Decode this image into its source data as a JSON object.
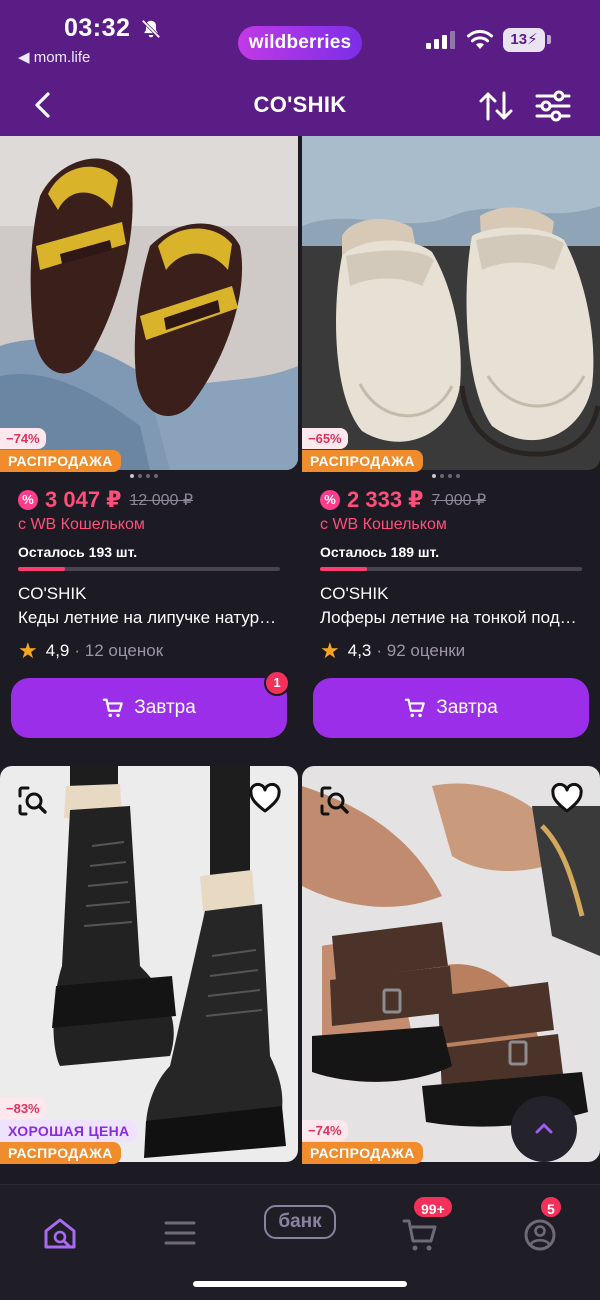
{
  "status_bar": {
    "time": "03:32",
    "back_app": "◀ mom.life",
    "brand_pill": "wildberries",
    "battery": "13"
  },
  "header": {
    "title": "CO'SHIK",
    "icons": [
      "back-arrow-icon",
      "sort-icon",
      "filter-icon"
    ]
  },
  "products": [
    {
      "discount": "−74%",
      "sale_label": "РАСПРОДАЖА",
      "price": "3 047 ₽",
      "old_price": "12 000 ₽",
      "wallet_text": "с WB Кошельком",
      "stock_text": "Осталось 193 шт.",
      "stock_level": 0.18,
      "brand": "CO'SHIK",
      "name": "Кеды летние на липучке натуральная замша",
      "rating": "4,9",
      "reviews": "· 12 оценок",
      "button": "Завтра",
      "cart_count": "1"
    },
    {
      "discount": "−65%",
      "sale_label": "РАСПРОДАЖА",
      "price": "2 333 ₽",
      "old_price": "7 000 ₽",
      "wallet_text": "с WB Кошельком",
      "stock_text": "Осталось 189 шт.",
      "stock_level": 0.18,
      "brand": "CO'SHIK",
      "name": "Лоферы летние на тонкой подошве",
      "rating": "4,3",
      "reviews": "· 92 оценки",
      "button": "Завтра"
    },
    {
      "discount": "−83%",
      "good_price_label": "ХОРОШАЯ ЦЕНА",
      "sale_label": "РАСПРОДАЖА"
    },
    {
      "discount": "−74%",
      "sale_label": "РАСПРОДАЖА"
    }
  ],
  "tabbar": {
    "bank_label": "банк",
    "cart_badge": "99+",
    "profile_badge": "5",
    "icons": [
      "home-search-icon",
      "catalog-icon",
      "bank-icon",
      "cart-icon",
      "profile-icon"
    ]
  },
  "colors": {
    "header_bg": "#5a1d86",
    "page_bg": "#1c1a22",
    "accent": "#9b2fe9",
    "price": "#ff4e7a",
    "sale": "#f08c2c"
  }
}
